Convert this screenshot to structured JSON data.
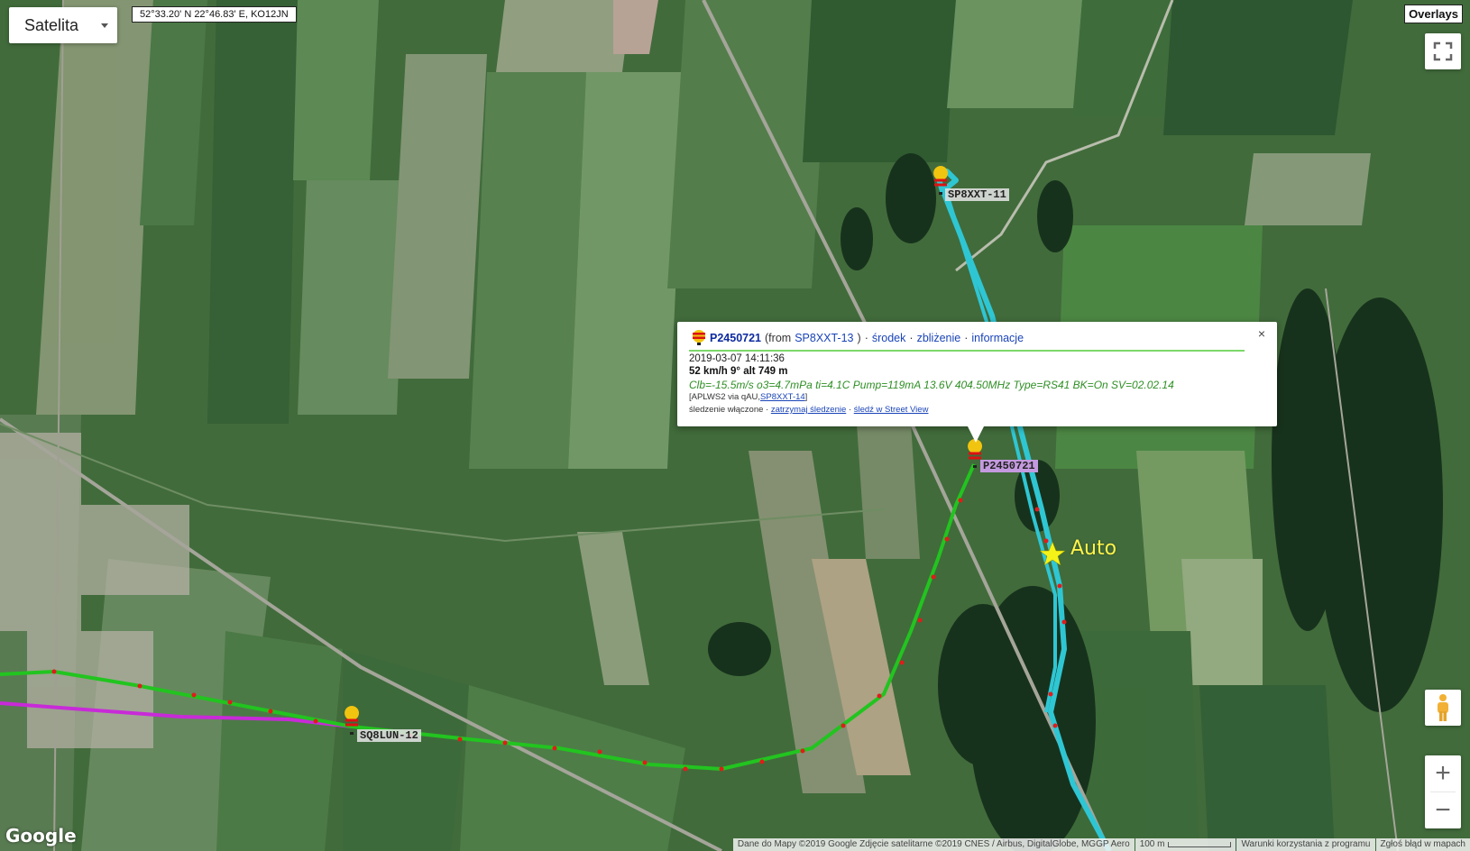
{
  "map_type": {
    "label": "Satelita"
  },
  "coords": "52°33.20' N 22°46.83' E, KO12JN",
  "overlays_label": "Overlays",
  "stations": [
    {
      "label": "SP8XXT-11",
      "style": "grey"
    },
    {
      "label": "P2450721",
      "style": "purple"
    },
    {
      "label": "SQ8LUN-12",
      "style": "grey"
    }
  ],
  "car": {
    "label": "Auto",
    "icon": "star-icon"
  },
  "popup": {
    "callsign": "P2450721",
    "from_prefix": "(from",
    "from_station": "SP8XXT-13",
    "from_suffix": ")",
    "links": [
      "środek",
      "zbliżenie",
      "informacje"
    ],
    "datetime": "2019-03-07 14:11:36",
    "speed_line": "52 km/h 9° alt 749 m",
    "comment": "Clb=-15.5m/s o3=4.7mPa ti=4.1C Pump=119mA 13.6V 404.50MHz Type=RS41 BK=On SV=02.02.14",
    "path_prefix": "[APLWS2 via qAU,",
    "path_station": "SP8XXT-14",
    "path_suffix": "]",
    "tracking_status": "śledzenie włączone",
    "tracking_links": [
      "zatrzymaj śledzenie",
      "śledź w Street View"
    ],
    "close": "×"
  },
  "attribution": "Dane do Mapy ©2019 Google Zdjęcie satelitarne ©2019 CNES / Airbus, DigitalGlobe, MGGP Aero",
  "scale_label": "100 m",
  "terms": "Warunki korzystania z programu",
  "report": "Zgłoś błąd w mapach",
  "google_logo": "Google",
  "zoom": {
    "in": "+",
    "out": "−"
  },
  "colors": {
    "balloon_track": "#22c41f",
    "receiver_track": "#2fc6d4",
    "secondary_track": "#c82ad8",
    "track_points": "#e21b1b",
    "car_star": "#f5f218"
  }
}
